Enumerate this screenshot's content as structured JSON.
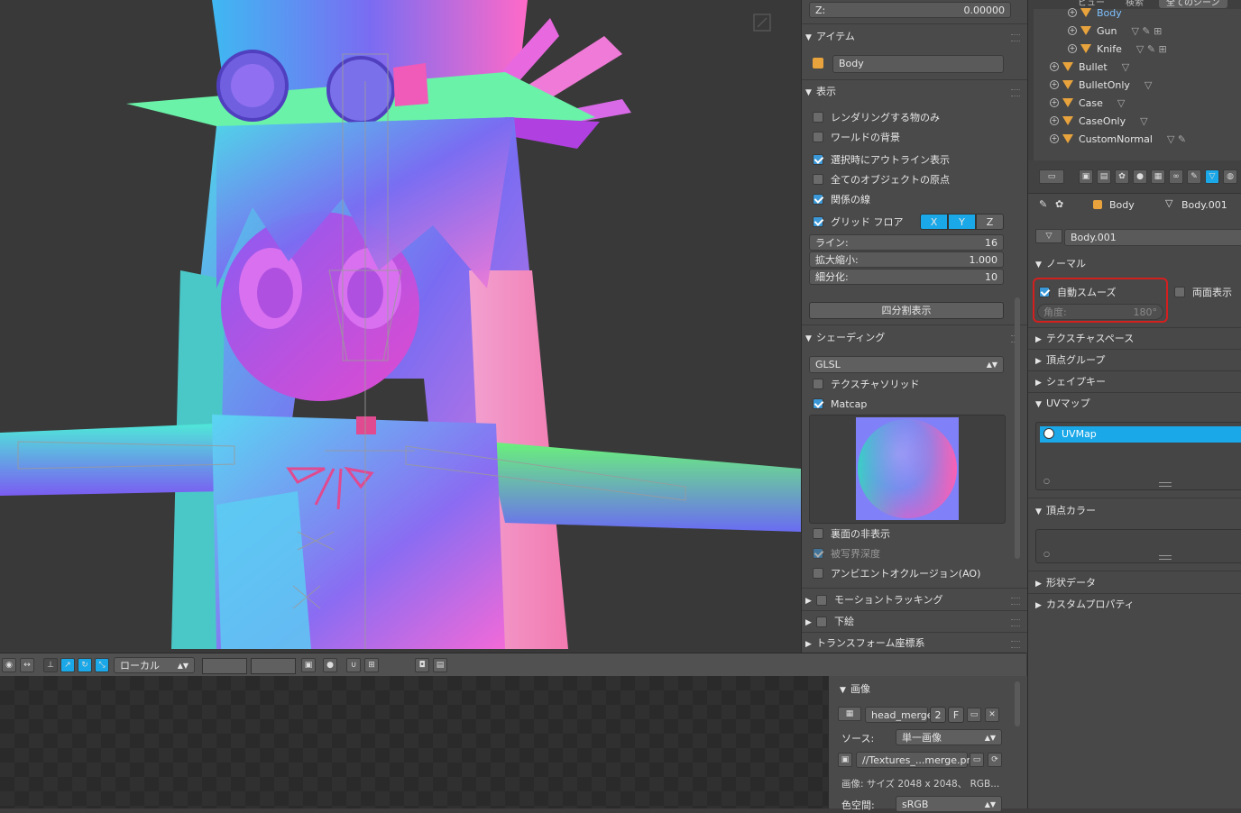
{
  "viewport": {
    "label": ""
  },
  "npanel": {
    "z_label": "Z:",
    "z_value": "0.00000",
    "item_section": "アイテム",
    "item_name": "Body",
    "display_section": "表示",
    "display_options": [
      {
        "label": "レンダリングする物のみ",
        "checked": false
      },
      {
        "label": "ワールドの背景",
        "checked": false
      },
      {
        "label": "選択時にアウトライン表示",
        "checked": true
      },
      {
        "label": "全てのオブジェクトの原点",
        "checked": false
      },
      {
        "label": "関係の線",
        "checked": true
      }
    ],
    "grid_floor": "グリッド フロア",
    "axis_x": "X",
    "axis_y": "Y",
    "axis_z": "Z",
    "lines_label": "ライン:",
    "lines_value": "16",
    "scale_label": "拡大縮小:",
    "scale_value": "1.000",
    "subdiv_label": "細分化:",
    "subdiv_value": "10",
    "quad_view": "四分割表示",
    "shading_section": "シェーディング",
    "shading_mode": "GLSL",
    "texture_solid": "テクスチャソリッド",
    "matcap": "Matcap",
    "backface": "裏面の非表示",
    "dof": "被写界深度",
    "ao": "アンビエントオクルージョン(AO)",
    "motion_tracking": "モーショントラッキング",
    "background_image": "下絵",
    "transform_orient": "トランスフォーム座標系"
  },
  "header": {
    "orientation": "ローカル"
  },
  "image_panel": {
    "section": "画像",
    "image_name": "head_merge",
    "users": "2",
    "fake": "F",
    "source_label": "ソース:",
    "source_value": "単一画像",
    "filepath": "//Textures_...merge.png",
    "info": "画像: サイズ 2048 x 2048、 RGB...",
    "colorspace_label": "色空間:",
    "colorspace_value": "sRGB"
  },
  "outliner": {
    "top_tabs": [
      "ビュー",
      "検索",
      "全てのシーン"
    ],
    "rows": [
      {
        "name": "Body",
        "indent": 2
      },
      {
        "name": "Gun",
        "indent": 2
      },
      {
        "name": "Knife",
        "indent": 2
      },
      {
        "name": "Bullet",
        "indent": 1
      },
      {
        "name": "BulletOnly",
        "indent": 1
      },
      {
        "name": "Case",
        "indent": 1
      },
      {
        "name": "CaseOnly",
        "indent": 1
      },
      {
        "name": "CustomNormal",
        "indent": 1
      }
    ]
  },
  "props": {
    "breadcrumb_obj": "Body",
    "breadcrumb_mesh": "Body.001",
    "mesh_name": "Body.001",
    "normals_section": "ノーマル",
    "auto_smooth": "自動スムーズ",
    "double_sided": "両面表示",
    "angle_label": "角度:",
    "angle_value": "180°",
    "texture_space": "テクスチャスペース",
    "vertex_groups": "頂点グループ",
    "shape_keys": "シェイプキー",
    "uv_maps": "UVマップ",
    "uv_map_item": "UVMap",
    "vertex_colors": "頂点カラー",
    "geometry_data": "形状データ",
    "custom_props": "カスタムプロパティ"
  },
  "colors": {
    "accent": "#3a98d8",
    "highlight": "#d41f1f",
    "select": "#1aa8e8"
  }
}
